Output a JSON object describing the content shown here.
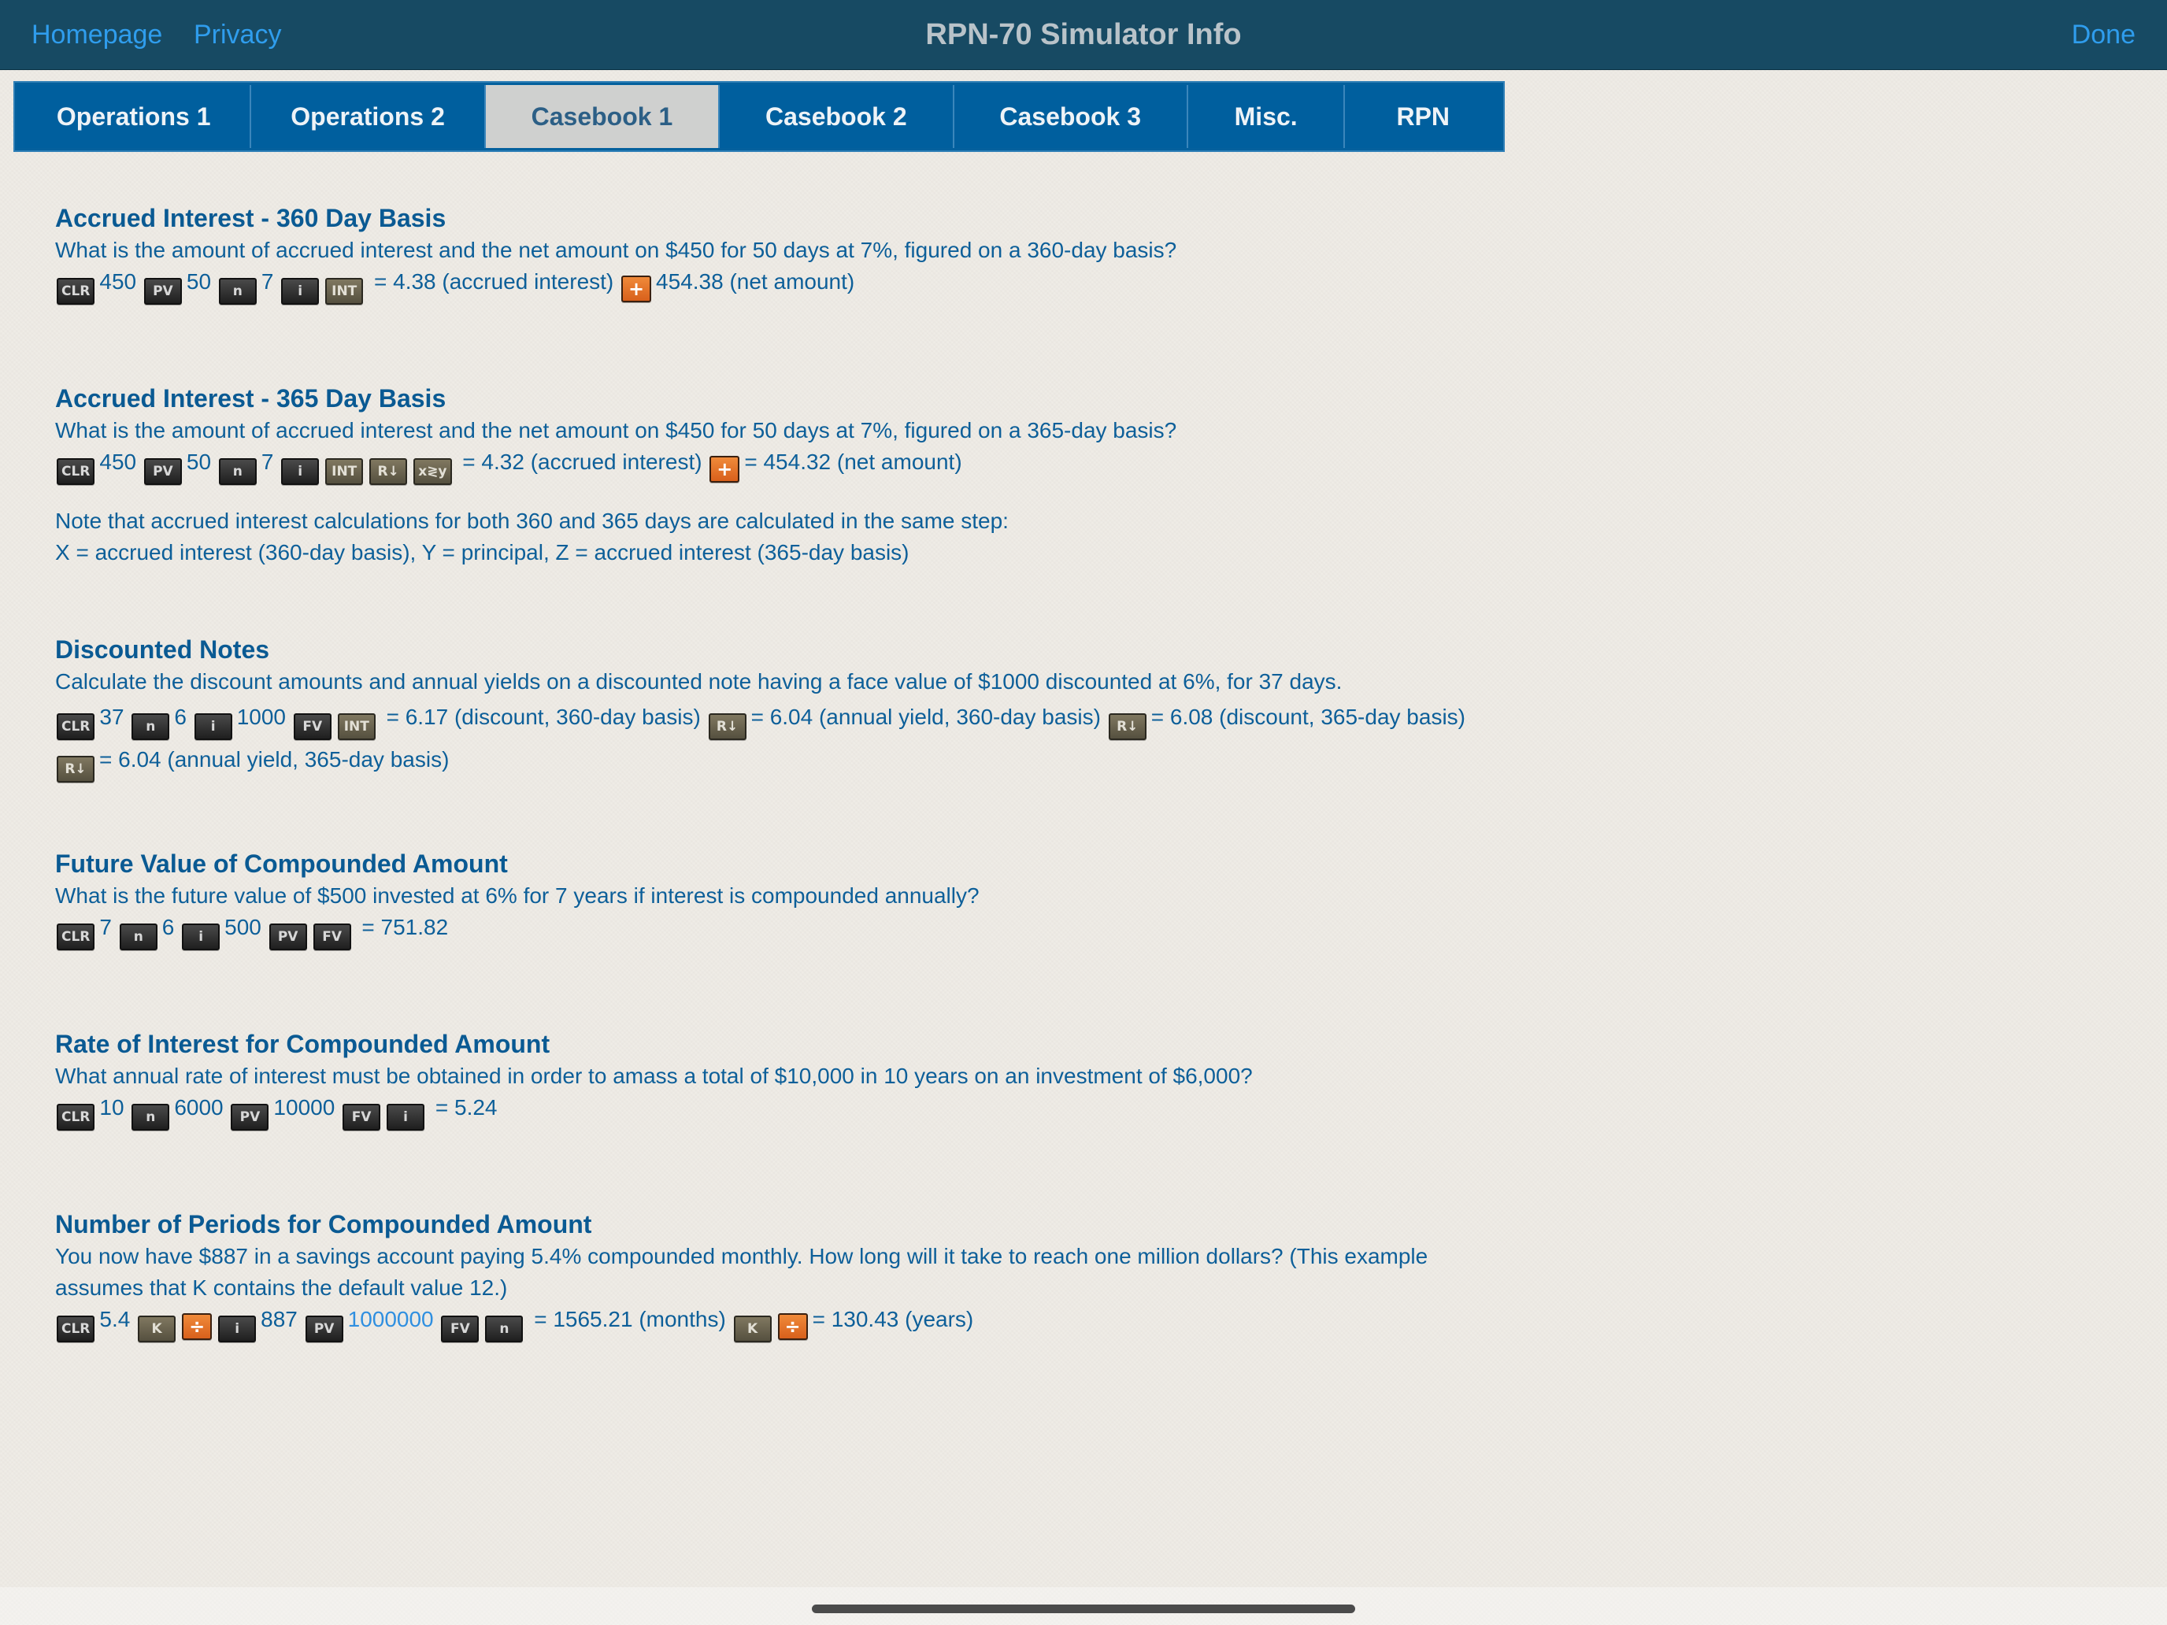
{
  "nav": {
    "homepage": "Homepage",
    "privacy": "Privacy",
    "title": "RPN-70 Simulator Info",
    "done": "Done"
  },
  "tabs": [
    {
      "label": "Operations 1"
    },
    {
      "label": "Operations 2"
    },
    {
      "label": "Casebook 1"
    },
    {
      "label": "Casebook 2"
    },
    {
      "label": "Casebook 3"
    },
    {
      "label": "Misc."
    },
    {
      "label": "RPN"
    }
  ],
  "active_tab": "Casebook 1",
  "keys": {
    "clr": "CLR",
    "pv": "PV",
    "n": "n",
    "i": "i",
    "int": "INT",
    "fv": "FV",
    "rdown": "R↓",
    "xy": "x≷y",
    "k": "K",
    "plus": "+",
    "div": "÷"
  },
  "sections": {
    "s1": {
      "title": "Accrued Interest - 360 Day Basis",
      "question": "What is the amount of accrued interest and the net amount on $450 for 50 days at 7%, figured on a 360-day basis?",
      "v1": "450",
      "v2": "50",
      "v3": "7",
      "r1": "= 4.38 (accrued interest)",
      "r2": "454.38 (net amount)"
    },
    "s2": {
      "title": "Accrued Interest - 365 Day Basis",
      "question": "What is the amount of accrued interest and the net amount on $450 for 50 days at 7%, figured on a 365-day basis?",
      "v1": "450",
      "v2": "50",
      "v3": "7",
      "r1": "= 4.32 (accrued interest)",
      "r2": "= 454.32 (net amount)",
      "note1": "Note that accrued interest calculations for both 360 and 365 days are calculated in the same step:",
      "note2": "X = accrued interest (360-day basis), Y = principal, Z = accrued interest (365-day basis)"
    },
    "s3": {
      "title": "Discounted Notes",
      "question": "Calculate the discount amounts and annual yields on a discounted note having a face value of $1000 discounted at 6%, for 37 days.",
      "v1": "37",
      "v2": "6",
      "v3": "1000",
      "r1": "= 6.17 (discount, 360-day basis)",
      "r2": "= 6.04 (annual yield, 360-day basis)",
      "r3": "= 6.08 (discount, 365-day basis)",
      "r4": "= 6.04 (annual yield, 365-day basis)"
    },
    "s4": {
      "title": "Future Value of Compounded Amount",
      "question": "What is the future value of $500 invested at 6% for 7 years if interest is compounded annually?",
      "v1": "7",
      "v2": "6",
      "v3": "500",
      "r1": "= 751.82"
    },
    "s5": {
      "title": "Rate of Interest for Compounded Amount",
      "question": "What annual rate of interest must be obtained in order to amass a total of $10,000 in 10 years on an investment of $6,000?",
      "v1": "10",
      "v2": "6000",
      "v3": "10000",
      "r1": "= 5.24"
    },
    "s6": {
      "title": "Number of Periods for Compounded Amount",
      "question": "You now have $887 in a savings account paying 5.4% compounded monthly. How long will it take to reach one million dollars? (This example assumes that K contains the default value 12.)",
      "v1": "5.4",
      "v2": "887",
      "v3": "1000000",
      "r1": "= 1565.21 (months)",
      "r2": "= 130.43 (years)"
    }
  },
  "colors": {
    "navbar": "#174a63",
    "tab": "#005f9e",
    "tab_active": "#cfd0cf",
    "text": "#0d5f99",
    "link": "#2f9ded",
    "orange_key": "#e8752a"
  }
}
